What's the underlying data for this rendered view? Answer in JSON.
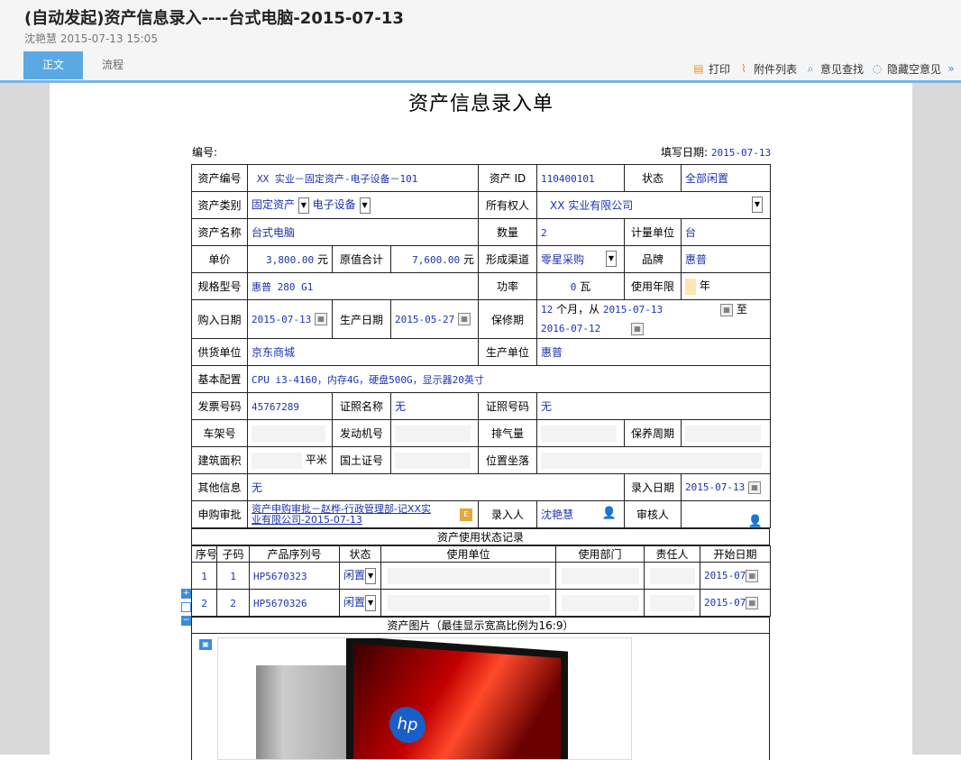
{
  "header": {
    "title": "(自动发起)资产信息录入----台式电脑-2015-07-13",
    "subtitle": "沈艳慧 2015-07-13 15:05",
    "tabs": [
      "正文",
      "流程"
    ],
    "toolbar": {
      "print": "打印",
      "attachments": "附件列表",
      "search_opinion": "意见查找",
      "hide_empty": "隐藏空意见"
    }
  },
  "form": {
    "title": "资产信息录入单",
    "serial_label": "编号:",
    "fill_date_label": "填写日期:",
    "fill_date": "2015-07-13",
    "labels": {
      "asset_no": "资产编号",
      "asset_id": "资产 ID",
      "status": "状态",
      "asset_type": "资产类别",
      "owner": "所有权人",
      "asset_name": "资产名称",
      "quantity": "数量",
      "unit": "计量单位",
      "price": "单价",
      "total": "原值合计",
      "channel": "形成渠道",
      "brand": "品牌",
      "model": "规格型号",
      "power": "功率",
      "life": "使用年限",
      "buy_date": "购入日期",
      "prod_date": "生产日期",
      "warranty": "保修期",
      "supplier": "供货单位",
      "producer": "生产单位",
      "config": "基本配置",
      "invoice": "发票号码",
      "cert_name": "证照名称",
      "cert_no": "证照号码",
      "frame_no": "车架号",
      "engine_no": "发动机号",
      "displacement": "排气量",
      "maintain": "保养周期",
      "area": "建筑面积",
      "land_cert": "国土证号",
      "location": "位置坐落",
      "other": "其他信息",
      "entry_date": "录入日期",
      "purchase": "申购审批",
      "entry_user": "录入人",
      "reviewer": "审核人"
    },
    "values": {
      "asset_no": "XX 实业－固定资产-电子设备－101",
      "asset_id": "110400101",
      "status": "全部闲置",
      "asset_type_1": "固定资产",
      "asset_type_2": "电子设备",
      "owner": "XX 实业有限公司",
      "asset_name": "台式电脑",
      "quantity": "2",
      "unit": "台",
      "price": "3,800.00",
      "price_unit": "元",
      "total": "7,600.00",
      "total_unit": "元",
      "channel": "零星采购",
      "brand": "惠普",
      "model": "惠普 280 G1",
      "power": "0",
      "power_unit": "瓦",
      "life_unit": "年",
      "buy_date": "2015-07-13",
      "prod_date": "2015-05-27",
      "warranty_months": "12",
      "warranty_text": "个月，从",
      "warranty_from": "2015-07-13",
      "warranty_to_label": "至",
      "warranty_to": "2016-07-12",
      "supplier": "京东商城",
      "producer": "惠普",
      "config": "CPU i3-4160，内存4G，硬盘500G，显示器20英寸",
      "invoice": "45767289",
      "cert_name": "无",
      "cert_no": "无",
      "area_unit": "平米",
      "other": "无",
      "entry_date": "2015-07-13",
      "purchase_line1": "资产申购审批－赵桦-行政管理部-记XX实",
      "purchase_line2": "业有限公司-2015-07-13",
      "entry_user": "沈艳慧"
    },
    "usage_section": "资产使用状态记录",
    "usage_headers": [
      "序号",
      "子码",
      "产品序列号",
      "状态",
      "使用单位",
      "使用部门",
      "责任人",
      "开始日期"
    ],
    "usage_rows": [
      {
        "no": "1",
        "code": "1",
        "serial": "HP5670323",
        "status": "闲置",
        "date": "2015-07"
      },
      {
        "no": "2",
        "code": "2",
        "serial": "HP5670326",
        "status": "闲置",
        "date": "2015-07"
      }
    ],
    "image_section": "资产图片（最佳显示宽高比例为16:9）"
  },
  "colors": {
    "accent": "#5ba9e2",
    "value_text": "#1a33b3"
  }
}
